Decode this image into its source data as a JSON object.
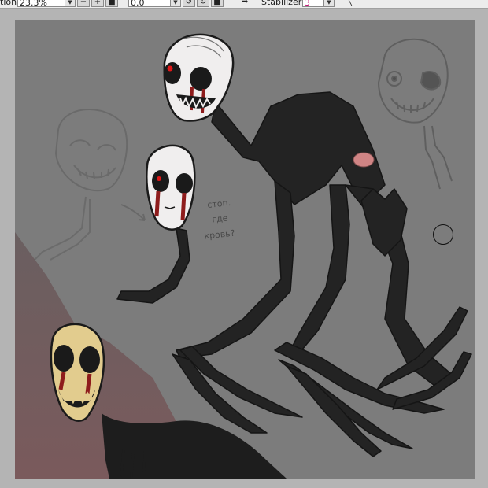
{
  "toolbar": {
    "zoom_label": "tion",
    "zoom_value": "23.3%",
    "angle_value": "0.0",
    "stabilizer_label": "Stabilizer",
    "stabilizer_value": "3",
    "icons": [
      "minus-icon",
      "plus-icon",
      "fit-icon",
      "rotate-left-icon",
      "rotate-right-icon",
      "reset-icon",
      "arrow-icon",
      "brush-icon"
    ]
  },
  "canvas": {
    "background": "#7c7c7c",
    "note_lines": [
      "стоп.",
      "где",
      "кровь?"
    ]
  },
  "colors": {
    "blood": "#8e1c1c",
    "eye": "#e01818",
    "creature": "#232323",
    "skull_bone": "#e2cc8e"
  }
}
